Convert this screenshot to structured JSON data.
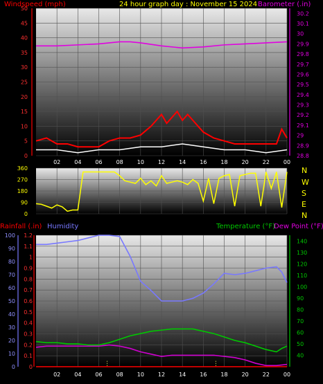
{
  "header": {
    "title": "24 hour graph day : November 15 2024",
    "wind_label": "Windspeed (mph)",
    "baro_label": "Barometer (.in)"
  },
  "dir_labels": [
    "N",
    "W",
    "S",
    "E",
    "N"
  ],
  "bottom_header": {
    "rain_label": "Rainfall (.in)",
    "hum_label": "Humidity",
    "temp_label": "Temperature (°F)",
    "dew_label": "Dew Point (°F)"
  },
  "colors": {
    "wind": "#ff0000",
    "gust_bar": "#ff2020",
    "avg_wind": "#ffffff",
    "wind_low": "#00c800",
    "baro": "#e000e0",
    "title": "#ffff00",
    "dir": "#ffff00",
    "rain": "#ff0000",
    "humidity": "#7878ff",
    "temp": "#00c800",
    "dew": "#d000d0",
    "rain_bar": "#ffff60"
  },
  "chart_data": [
    {
      "type": "line",
      "name": "wind_baro",
      "x_ticks": [
        "02",
        "04",
        "06",
        "08",
        "10",
        "12",
        "14",
        "16",
        "18",
        "20",
        "22",
        "00"
      ],
      "left_axis": {
        "label": "Windspeed (mph)",
        "ticks": [
          0,
          5,
          10,
          15,
          20,
          25,
          30,
          35,
          40,
          45,
          50
        ],
        "ylim": [
          0,
          50
        ]
      },
      "right_axis": {
        "label": "Barometer (.in)",
        "ticks": [
          "28.8",
          "28.9",
          "29",
          "29.1",
          "29.2",
          "29.3",
          "29.4",
          "29.5",
          "29.6",
          "29.7",
          "29.8",
          "29.9",
          "30",
          "30.1",
          "30.2"
        ],
        "ylim": [
          28.8,
          30.25
        ]
      },
      "series": [
        {
          "name": "Windspeed (mph)",
          "axis": "left",
          "x": [
            0,
            1,
            2,
            3,
            4,
            5,
            6,
            7,
            8,
            9,
            10,
            11,
            11.5,
            12,
            12.5,
            13,
            13.5,
            14,
            14.5,
            15,
            15.5,
            16,
            17,
            18,
            19,
            20,
            21,
            22,
            23,
            23.5,
            24
          ],
          "y": [
            5,
            6,
            4,
            4,
            3,
            3,
            3,
            5,
            6,
            6,
            7,
            10,
            12,
            14,
            11,
            13,
            15,
            12,
            14,
            12,
            10,
            8,
            6,
            5,
            4,
            4,
            4,
            4,
            4,
            9,
            6
          ]
        },
        {
          "name": "Avg wind",
          "axis": "left",
          "x": [
            0,
            2,
            4,
            6,
            8,
            10,
            12,
            14,
            16,
            18,
            20,
            22,
            24
          ],
          "y": [
            2,
            2,
            1,
            2,
            2,
            3,
            3,
            4,
            3,
            2,
            2,
            1,
            2
          ]
        },
        {
          "name": "Barometer (.in)",
          "axis": "right",
          "x": [
            0,
            2,
            4,
            6,
            8,
            9,
            10,
            12,
            14,
            16,
            18,
            20,
            22,
            24
          ],
          "y": [
            29.88,
            29.88,
            29.89,
            29.9,
            29.92,
            29.92,
            29.91,
            29.88,
            29.86,
            29.87,
            29.89,
            29.9,
            29.91,
            29.92
          ]
        }
      ]
    },
    {
      "type": "scatter",
      "name": "wind_direction",
      "y_ticks": [
        0,
        90,
        180,
        270,
        360
      ],
      "ylim": [
        0,
        360
      ],
      "right_labels": [
        "N",
        "W",
        "S",
        "E",
        "N"
      ],
      "series": [
        {
          "name": "Direction",
          "x": [
            0,
            0.5,
            1,
            1.5,
            2,
            2.5,
            3,
            3.5,
            4,
            4.5,
            5,
            5.5,
            6,
            6.5,
            7,
            7.5,
            8,
            8.5,
            9,
            9.5,
            10,
            10.5,
            11,
            11.5,
            12,
            12.5,
            13,
            13.5,
            14,
            14.5,
            15,
            15.5,
            16,
            16.5,
            17,
            17.5,
            18,
            18.5,
            19,
            19.5,
            20,
            20.5,
            21,
            21.5,
            22,
            22.5,
            23,
            23.5,
            24
          ],
          "y": [
            80,
            75,
            60,
            45,
            70,
            55,
            20,
            30,
            30,
            330,
            330,
            330,
            330,
            330,
            330,
            330,
            300,
            260,
            250,
            240,
            280,
            230,
            260,
            220,
            300,
            240,
            250,
            260,
            250,
            230,
            270,
            240,
            100,
            280,
            80,
            280,
            300,
            310,
            60,
            300,
            310,
            320,
            320,
            60,
            330,
            200,
            330,
            50,
            330
          ]
        }
      ]
    },
    {
      "type": "line",
      "name": "rain_humidity_temp",
      "x_ticks": [
        "02",
        "04",
        "06",
        "08",
        "10",
        "12",
        "14",
        "16",
        "18",
        "20",
        "22",
        "00"
      ],
      "left_axis_rain": {
        "label": "Rainfall (.in)",
        "ticks": [
          "0",
          "0.1",
          "0.2",
          "0.3",
          "0.4",
          "0.5",
          "0.6",
          "0.7",
          "0.8",
          "0.9",
          "1",
          "1.1",
          "1.2"
        ],
        "ylim": [
          0,
          1.2
        ]
      },
      "left_axis_humidity": {
        "label": "Humidity",
        "ticks": [
          0,
          10,
          20,
          30,
          40,
          50,
          60,
          70,
          80,
          90,
          100
        ],
        "ylim": [
          0,
          100
        ]
      },
      "right_axis": {
        "label": "Temperature (°F) Dew Point (°F)",
        "ticks": [
          40,
          50,
          60,
          70,
          80,
          90,
          100,
          110,
          120,
          130,
          140
        ],
        "ylim": [
          30,
          145
        ]
      },
      "series": [
        {
          "name": "Humidity",
          "axis": "humidity",
          "x": [
            0,
            1,
            2,
            3,
            4,
            5,
            6,
            7,
            8,
            9,
            10,
            11,
            12,
            13,
            14,
            15,
            16,
            17,
            18,
            19,
            20,
            21,
            22,
            23,
            23.5,
            24
          ],
          "y": [
            93,
            93,
            94,
            95,
            96,
            98,
            100,
            100,
            99,
            84,
            65,
            58,
            50,
            50,
            50,
            52,
            56,
            63,
            71,
            70,
            71,
            73,
            75,
            76,
            72,
            64
          ]
        },
        {
          "name": "Temperature (°F)",
          "axis": "temp",
          "x": [
            0,
            1,
            2,
            3,
            4,
            5,
            6,
            7,
            8,
            9,
            10,
            11,
            12,
            13,
            14,
            15,
            16,
            17,
            18,
            19,
            20,
            21,
            22,
            23,
            23.5,
            24
          ],
          "y": [
            52,
            51,
            51,
            50,
            50,
            49,
            49,
            51,
            54,
            57,
            59,
            61,
            62,
            63,
            63,
            63,
            61,
            59,
            56,
            53,
            51,
            48,
            45,
            43,
            46,
            48
          ]
        },
        {
          "name": "Dew Point (°F)",
          "axis": "temp",
          "x": [
            0,
            1,
            2,
            3,
            4,
            5,
            6,
            7,
            8,
            9,
            10,
            11,
            12,
            13,
            14,
            15,
            16,
            17,
            18,
            19,
            20,
            21,
            22,
            23,
            24
          ],
          "y": [
            47,
            48,
            48,
            48,
            48,
            48,
            48,
            49,
            48,
            46,
            43,
            41,
            39,
            40,
            40,
            40,
            40,
            40,
            39,
            38,
            36,
            33,
            31,
            31,
            32
          ]
        },
        {
          "name": "Rainfall (.in)",
          "axis": "rain",
          "x": [
            0,
            24
          ],
          "y": [
            0,
            0
          ]
        }
      ]
    }
  ]
}
